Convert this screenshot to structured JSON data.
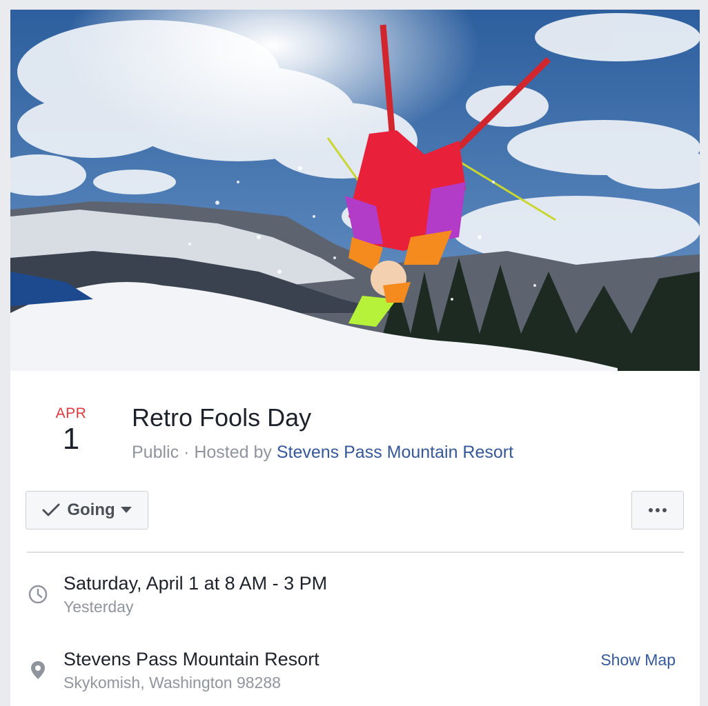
{
  "cover": {
    "alt": "Skier doing a backflip in retro neon gear above snow",
    "colors": {
      "sky": "#3d6fae",
      "snow": "#f2f4f7",
      "jacket": "#e8203a",
      "accent_orange": "#f58a1f",
      "accent_purple": "#b23bc8",
      "accent_lime": "#b6f23a"
    }
  },
  "event": {
    "month": "APR",
    "day": "1",
    "title": "Retro Fools Day",
    "privacy": "Public",
    "hosted_by_label": "· Hosted by",
    "host": "Stevens Pass Mountain Resort"
  },
  "actions": {
    "going_label": "Going",
    "check_icon": "check-icon",
    "caret_icon": "caret-down-icon",
    "more_icon": "more-dots-icon"
  },
  "details": {
    "time": {
      "icon": "clock-icon",
      "primary": "Saturday, April 1 at 8 AM - 3 PM",
      "secondary": "Yesterday"
    },
    "location": {
      "icon": "map-pin-icon",
      "primary": "Stevens Pass Mountain Resort",
      "secondary": "Skykomish, Washington 98288",
      "link": "Show Map"
    }
  },
  "theme": {
    "link_color": "#365899",
    "date_red": "#e0393e",
    "muted_text": "#90949c"
  }
}
